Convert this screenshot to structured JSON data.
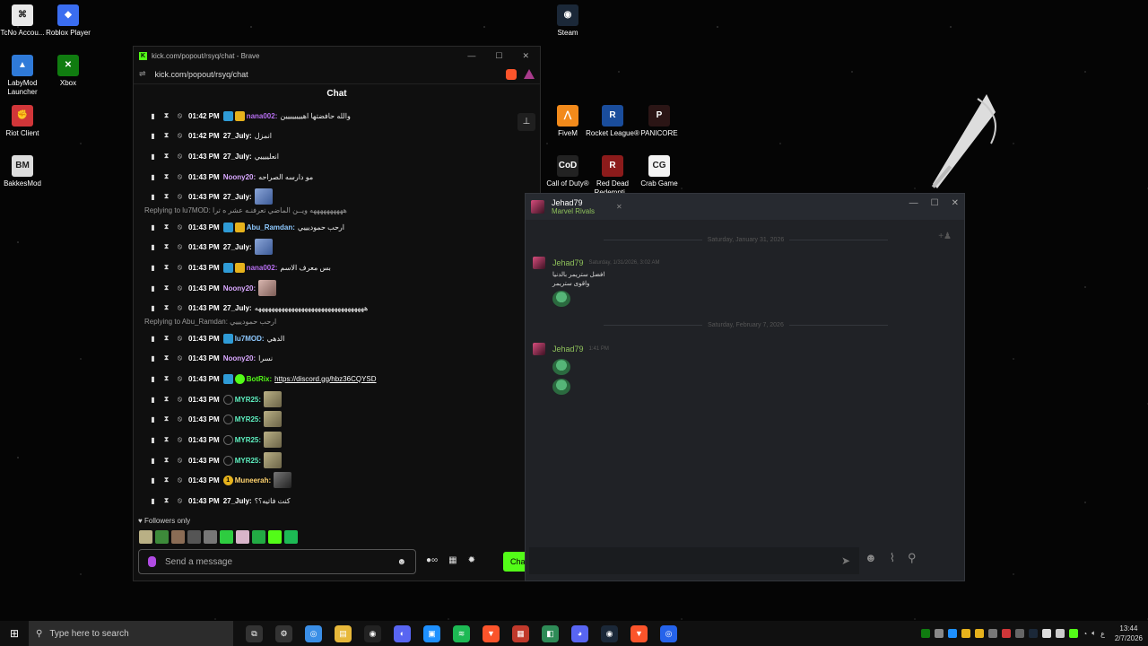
{
  "desktop": {
    "icons_left": [
      {
        "label": "TcNo Accou...",
        "color": "#e9e9e9",
        "glyph": "⌘"
      },
      {
        "label": "Roblox Player",
        "color": "#3a6df0",
        "glyph": "◆"
      },
      {
        "label": "LabyMod Launcher",
        "color": "#2f7ad8",
        "glyph": "▲"
      },
      {
        "label": "Xbox",
        "color": "#107c10",
        "glyph": "✕"
      },
      {
        "label": "Riot Client",
        "color": "#d13639",
        "glyph": "✊"
      },
      {
        "label": "BakkesMod",
        "color": "#dddddd",
        "glyph": "BM"
      }
    ],
    "icons_right": [
      {
        "label": "Steam",
        "color": "#1b2838",
        "glyph": "◉"
      },
      {
        "label": "FiveM",
        "color": "#f28a1b",
        "glyph": "⋀"
      },
      {
        "label": "Rocket League®",
        "color": "#1a4d9c",
        "glyph": "R"
      },
      {
        "label": "PANICORE",
        "color": "#2b1515",
        "glyph": "P"
      },
      {
        "label": "Call of Duty®",
        "color": "#222222",
        "glyph": "CoD"
      },
      {
        "label": "Red Dead Redempti...",
        "color": "#8c1b1b",
        "glyph": "R"
      },
      {
        "label": "Crab Game",
        "color": "#f3f3f3",
        "glyph": "CG"
      }
    ]
  },
  "brave": {
    "title": "kick.com/popout/rsyq/chat - Brave",
    "address": "kick.com/popout/rsyq/chat",
    "chat_header": "Chat",
    "messages": [
      {
        "time": "01:42 PM",
        "badges": [
          "mod",
          "crown"
        ],
        "user": "nana002:",
        "color": "#b66ef0",
        "text": "والله حافضتها اهيييييييين"
      },
      {
        "time": "01:42 PM",
        "badges": [],
        "user": "27_July:",
        "color": "#ffffff",
        "text": "انمزل"
      },
      {
        "time": "01:43 PM",
        "badges": [],
        "user": "27_July:",
        "color": "#ffffff",
        "text": "انعلييييي"
      },
      {
        "time": "01:43 PM",
        "badges": [],
        "user": "Noony20:",
        "color": "#d9a8ff",
        "text": "مو دارسه الصراحه"
      },
      {
        "time": "01:43 PM",
        "badges": [],
        "user": "27_July:",
        "color": "#ffffff",
        "emote": "blue"
      },
      {
        "time": "01:43 PM",
        "badges": [
          "mod",
          "crown"
        ],
        "user": "Abu_Ramdan:",
        "color": "#8ec9ff",
        "text": "ارحب حموديييي"
      },
      {
        "time": "01:43 PM",
        "badges": [],
        "user": "27_July:",
        "color": "#ffffff",
        "emote": "blue"
      },
      {
        "time": "01:43 PM",
        "badges": [
          "mod",
          "crown"
        ],
        "user": "nana002:",
        "color": "#b66ef0",
        "text": "بس معرف الاسم"
      },
      {
        "time": "01:43 PM",
        "badges": [],
        "user": "Noony20:",
        "color": "#d9a8ff",
        "emote": "pink"
      },
      {
        "time": "01:43 PM",
        "badges": [],
        "user": "27_July:",
        "color": "#ffffff",
        "text": "هههههههههههههههههههههههههههههههههه"
      },
      {
        "time": "01:43 PM",
        "badges": [
          "mod"
        ],
        "user": "lu7MOD:",
        "color": "#8ec9ff",
        "text": "الدهي"
      },
      {
        "time": "01:43 PM",
        "badges": [],
        "user": "Noony20:",
        "color": "#d9a8ff",
        "text": "نسرا"
      },
      {
        "time": "01:43 PM",
        "badges": [
          "mod",
          "bot"
        ],
        "user": "BotRix:",
        "color": "#53fc18",
        "link": "https://discord.gg/hbz36CQYSD"
      },
      {
        "time": "01:43 PM",
        "badges": [
          "sub"
        ],
        "user": "MYR25:",
        "color": "#5ef0c0",
        "emote": "tan"
      },
      {
        "time": "01:43 PM",
        "badges": [
          "sub"
        ],
        "user": "MYR25:",
        "color": "#5ef0c0",
        "emote": "tan"
      },
      {
        "time": "01:43 PM",
        "badges": [
          "sub"
        ],
        "user": "MYR25:",
        "color": "#5ef0c0",
        "emote": "tan"
      },
      {
        "time": "01:43 PM",
        "badges": [
          "sub"
        ],
        "user": "MYR25:",
        "color": "#5ef0c0",
        "emote": "tan"
      },
      {
        "time": "01:43 PM",
        "badges": [
          "one"
        ],
        "user": "Muneerah:",
        "color": "#ffd36e",
        "emote": "dark"
      },
      {
        "time": "01:43 PM",
        "badges": [],
        "user": "27_July:",
        "color": "#ffffff",
        "text": "كنت فاتيه؟؟"
      }
    ],
    "replies": [
      {
        "before_index": 5,
        "text": "Replying to lu7MOD: ههههههههههه ويــن الماضي تعرفنـه عشر ه ترا"
      },
      {
        "before_index": 10,
        "text": "Replying to Abu_Ramdan: ارحب حموديييي"
      }
    ],
    "followers_only": "Followers only",
    "send_placeholder": "Send a message",
    "chat_button": "Cha"
  },
  "steam": {
    "friend_name": "Jehad79",
    "friend_game": "Marvel Rivals",
    "date1": "Saturday, January 31, 2026",
    "date2": "Saturday, February 7, 2026",
    "msg1_name": "Jehad79",
    "msg1_time": "Saturday, 1/31/2026, 3:02 AM",
    "msg1_line1": "افضل ستريمر بالدنيا",
    "msg1_line2": "واقوى ستريمر",
    "msg2_name": "Jehad79",
    "msg2_time": "1:41 PM"
  },
  "taskbar": {
    "search_placeholder": "Type here to search",
    "apps": [
      {
        "name": "task-view",
        "color": "#333333",
        "glyph": "⧉"
      },
      {
        "name": "settings",
        "color": "#333333",
        "glyph": "⚙"
      },
      {
        "name": "chrome",
        "color": "#3a8ee6",
        "glyph": "◎"
      },
      {
        "name": "file-explorer",
        "color": "#e7b83a",
        "glyph": "▤"
      },
      {
        "name": "obs",
        "color": "#222222",
        "glyph": "◉"
      },
      {
        "name": "discord-ptb",
        "color": "#5865f2",
        "glyph": "◐"
      },
      {
        "name": "tool",
        "color": "#1e90ff",
        "glyph": "▣"
      },
      {
        "name": "spotify",
        "color": "#1db954",
        "glyph": "≋"
      },
      {
        "name": "brave",
        "color": "#fb542b",
        "glyph": "▼"
      },
      {
        "name": "app-red",
        "color": "#c0392b",
        "glyph": "▦"
      },
      {
        "name": "app-green",
        "color": "#2e8b57",
        "glyph": "◧"
      },
      {
        "name": "discord",
        "color": "#5865f2",
        "glyph": "◕"
      },
      {
        "name": "steam",
        "color": "#1b2838",
        "glyph": "◉"
      },
      {
        "name": "brave-active",
        "color": "#fb542b",
        "glyph": "▼"
      },
      {
        "name": "app-blue",
        "color": "#2563eb",
        "glyph": "◎"
      }
    ],
    "lang": "ع",
    "time": "13:44",
    "date": "2/7/2026"
  }
}
